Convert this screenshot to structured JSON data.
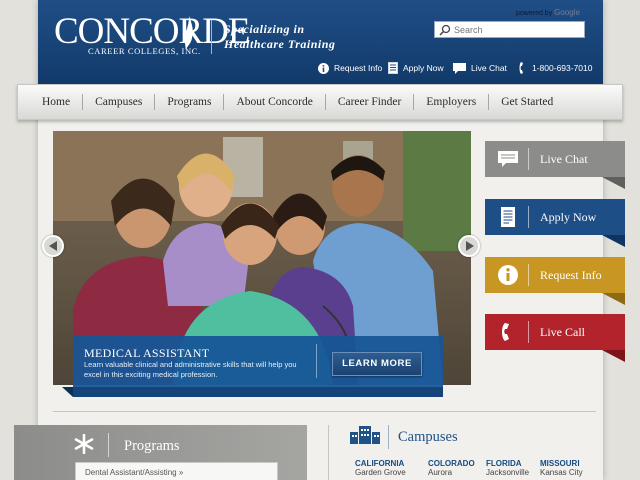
{
  "header": {
    "logo_name": "CONCORDE",
    "logo_mark": "®",
    "logo_sub": "CAREER COLLEGES, INC.",
    "tagline_line1": "Specializing in",
    "tagline_line2": "Healthcare Training",
    "powered_by_label": "powered by",
    "powered_by_brand": "Google",
    "search_placeholder": "Search",
    "utility": [
      {
        "label": "Request Info",
        "icon": "info-icon"
      },
      {
        "label": "Apply Now",
        "icon": "document-icon"
      },
      {
        "label": "Live Chat",
        "icon": "chat-icon"
      },
      {
        "label": "1-800-693-7010",
        "icon": "phone-icon"
      }
    ]
  },
  "nav": {
    "items": [
      "Home",
      "Campuses",
      "Programs",
      "About Concorde",
      "Career Finder",
      "Employers",
      "Get Started"
    ]
  },
  "hero": {
    "title": "MEDICAL ASSISTANT",
    "text": "Learn valuable clinical and administrative skills that will help you excel in this exciting medical profession.",
    "button": "LEARN MORE"
  },
  "side_buttons": [
    {
      "label": "Live Chat",
      "icon": "chat-icon",
      "color": "#8c8c8a"
    },
    {
      "label": "Apply Now",
      "icon": "document-icon",
      "color": "#1d4e86"
    },
    {
      "label": "Request Info",
      "icon": "info-icon",
      "color": "#c89622"
    },
    {
      "label": "Live Call",
      "icon": "phone-icon",
      "color": "#b3232b"
    }
  ],
  "programs": {
    "title": "Programs",
    "select_value": "Dental Assistant/Assisting »"
  },
  "campuses": {
    "title": "Campuses",
    "states": [
      {
        "state": "CALIFORNIA",
        "city": "Garden Grove"
      },
      {
        "state": "COLORADO",
        "city": "Aurora"
      },
      {
        "state": "FLORIDA",
        "city": "Jacksonville"
      },
      {
        "state": "MISSOURI",
        "city": "Kansas City"
      }
    ]
  },
  "colors": {
    "brand_blue": "#1d4e86",
    "gold": "#c89622",
    "red": "#b3232b",
    "gray": "#8c8c8a"
  }
}
